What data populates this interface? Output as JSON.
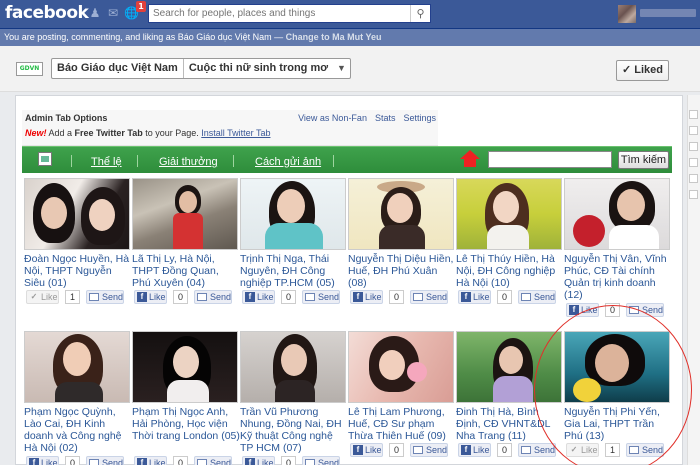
{
  "topbar": {
    "logo": "facebook",
    "notification_count": "1",
    "search_placeholder": "Search for people, places and things"
  },
  "strip": {
    "text": "You are posting, commenting, and liking as Báo Giáo dục Việt Nam — ",
    "change_link": "Change to Ma Mut Yeu"
  },
  "page_header": {
    "page_name": "Báo Giáo dục Việt Nam",
    "tab_name": "Cuộc thi nữ sinh trong mơ",
    "liked_label": "✓ Liked"
  },
  "admin": {
    "title": "Admin Tab Options",
    "view_nonfan": "View as Non-Fan",
    "stats": "Stats",
    "settings": "Settings",
    "new_label": "New!",
    "promo_text_1": " Add a ",
    "promo_bold": "Free Twitter Tab",
    "promo_text_2": " to your Page. ",
    "install_link": "Install Twitter Tab"
  },
  "nav": {
    "item1": "Thể lệ",
    "item2": "Giải thưởng",
    "item3": "Cách gửi ảnh",
    "search_button": "Tìm kiếm"
  },
  "buttons": {
    "like": "Like",
    "send": "Send",
    "fb_letter": "f"
  },
  "cards": [
    {
      "caption": "Đoàn Ngọc Huyền, Hà Nội, THPT Nguyễn Siêu (01)",
      "count": "1"
    },
    {
      "caption": "Lã Thị Ly, Hà Nội, THPT Đồng Quan, Phú Xuyên (04)",
      "count": "0"
    },
    {
      "caption": "Trịnh Thị Nga, Thái Nguyên, ĐH Công nghiệp TP.HCM (05)",
      "count": "0"
    },
    {
      "caption": "Nguyễn Thị Diệu Hiền, Huế, ĐH Phú Xuân (08)",
      "count": "0"
    },
    {
      "caption": "Lê Thị Thúy Hiền, Hà Nội, ĐH Công nghiệp Hà Nội (10)",
      "count": "0"
    },
    {
      "caption": "Nguyễn Thị Vân, Vĩnh Phúc, CĐ Tài chính Quản trị kinh doanh (12)",
      "count": "0"
    },
    {
      "caption": "Phạm Ngọc Quỳnh, Lào Cai, ĐH Kinh doanh và Công nghệ Hà Nội (02)",
      "count": "0"
    },
    {
      "caption": "Phạm Thị Ngọc Anh, Hải Phòng, Học viện Thời trang London (05)",
      "count": "0"
    },
    {
      "caption": "Trần Vũ Phương Nhung, Đồng Nai, ĐH Kỹ thuật Công nghệ TP HCM (07)",
      "count": "0"
    },
    {
      "caption": "Lê Thị Lam Phương, Huế, CĐ Sư phạm Thừa Thiên Huế (09)",
      "count": "0"
    },
    {
      "caption": "Đinh Thị Hà, Bình Định, CĐ VHNT&DL Nha Trang (11)",
      "count": "0"
    },
    {
      "caption": "Nguyễn Thị Phi Yến, Gia Lai, THPT Trần Phú (13)",
      "count": "1"
    }
  ]
}
